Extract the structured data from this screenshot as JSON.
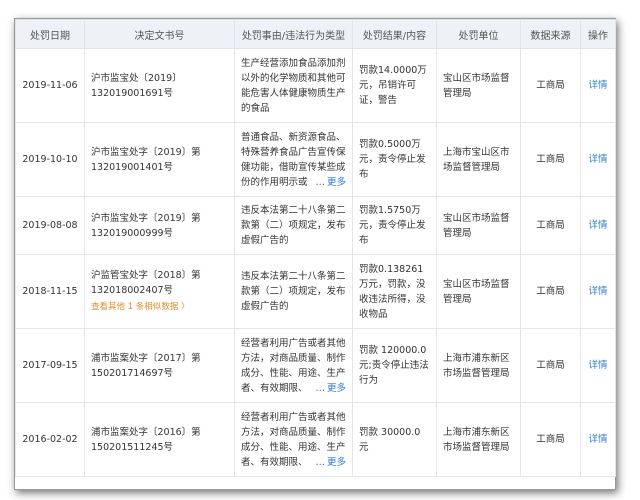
{
  "headers": [
    "处罚日期",
    "决定文书号",
    "处罚事由/违法行为类型",
    "处罚结果/内容",
    "处罚单位",
    "数据来源",
    "操作"
  ],
  "rows": [
    {
      "date": "2019-11-06",
      "doc": "沪市监宝处〔2019〕132019001691号",
      "reason": "生产经营添加食品添加剂以外的化学物质和其他可能危害人体健康物质生产的食品",
      "more": "",
      "result": "罚款14.0000万元，吊销许可证，警告",
      "unit": "宝山区市场监督管理局",
      "source": "工商局",
      "action": "详情"
    },
    {
      "date": "2019-10-10",
      "doc": "沪市监宝处字〔2019〕第132019001401号",
      "reason": "普通食品、新资源食品、特殊营养食品广告宣传保健功能，借助宣传某些成份的作用明示或",
      "more": "更多",
      "result": "罚款0.5000万元，责令停止发布",
      "unit": "上海市宝山区市场监督管理局",
      "source": "工商局",
      "action": "详情"
    },
    {
      "date": "2019-08-08",
      "doc": "沪市监宝处字〔2019〕第132019000999号",
      "reason": "违反本法第二十八条第二款第（二）项规定，发布虚假广告的",
      "more": "",
      "result": "罚款1.5750万元，责令停止发布",
      "unit": "宝山区市场监督管理局",
      "source": "工商局",
      "action": "详情"
    },
    {
      "date": "2018-11-15",
      "doc": "沪监管宝处字〔2018〕第132018002407号",
      "related": "查看其他 1 条相似数据 〉",
      "reason": "违反本法第二十八条第二款第（二）项规定，发布虚假广告的",
      "more": "",
      "result": "罚款0.138261万元，罚款，没收违法所得，没收物品",
      "unit": "宝山区市场监督管理局",
      "source": "工商局",
      "action": "详情"
    },
    {
      "date": "2017-09-15",
      "doc": "浦市监案处字〔2017〕第150201714697号",
      "reason": "经营者利用广告或者其他方法，对商品质量、制作成分、性能、用途、生产者、有效期限、",
      "more": "更多",
      "result": "罚款 120000.0 元;责令停止违法行为",
      "unit": "上海市浦东新区市场监督管理局",
      "source": "工商局",
      "action": "详情"
    },
    {
      "date": "2016-02-02",
      "doc": "浦市监案处字〔2016〕第150201511245号",
      "reason": "经营者利用广告或者其他方法，对商品质量、制作成分、性能、用途、生产者、有效期限、",
      "more": "更多",
      "result": "罚款 30000.0 元",
      "unit": "上海市浦东新区市场监督管理局",
      "source": "工商局",
      "action": "详情"
    }
  ]
}
